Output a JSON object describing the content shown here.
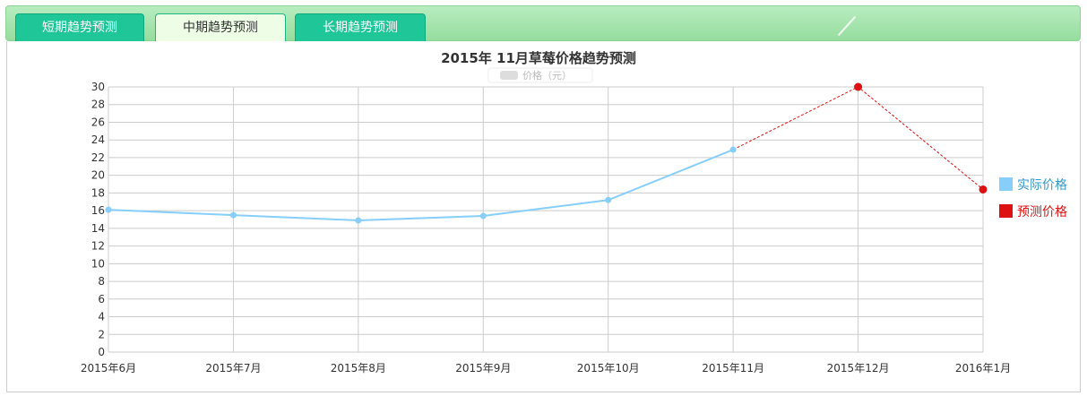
{
  "tabs": [
    {
      "label": "短期趋势预测",
      "active": false
    },
    {
      "label": "中期趋势预测",
      "active": true
    },
    {
      "label": "长期趋势预测",
      "active": false
    }
  ],
  "colors": {
    "actual": "#87cefa",
    "forecast": "#dd1111",
    "grid": "#cccccc"
  },
  "chart_data": {
    "type": "line",
    "title": "2015年  11月草莓价格趋势预测",
    "unit_label": "价格（元）",
    "categories": [
      "2015年6月",
      "2015年7月",
      "2015年8月",
      "2015年9月",
      "2015年10月",
      "2015年11月",
      "2015年12月",
      "2016年1月"
    ],
    "ylim": [
      0,
      30
    ],
    "yticks": [
      0,
      2,
      4,
      6,
      8,
      10,
      12,
      14,
      16,
      18,
      20,
      22,
      24,
      26,
      28,
      30
    ],
    "grid": true,
    "legend_position": "right",
    "series": [
      {
        "name": "实际价格",
        "style": "solid",
        "values": [
          16.1,
          15.5,
          14.9,
          15.4,
          17.2,
          22.9,
          null,
          null
        ]
      },
      {
        "name": "预测价格",
        "style": "dashed",
        "values": [
          null,
          null,
          null,
          null,
          null,
          22.9,
          30.0,
          18.4
        ]
      }
    ]
  }
}
